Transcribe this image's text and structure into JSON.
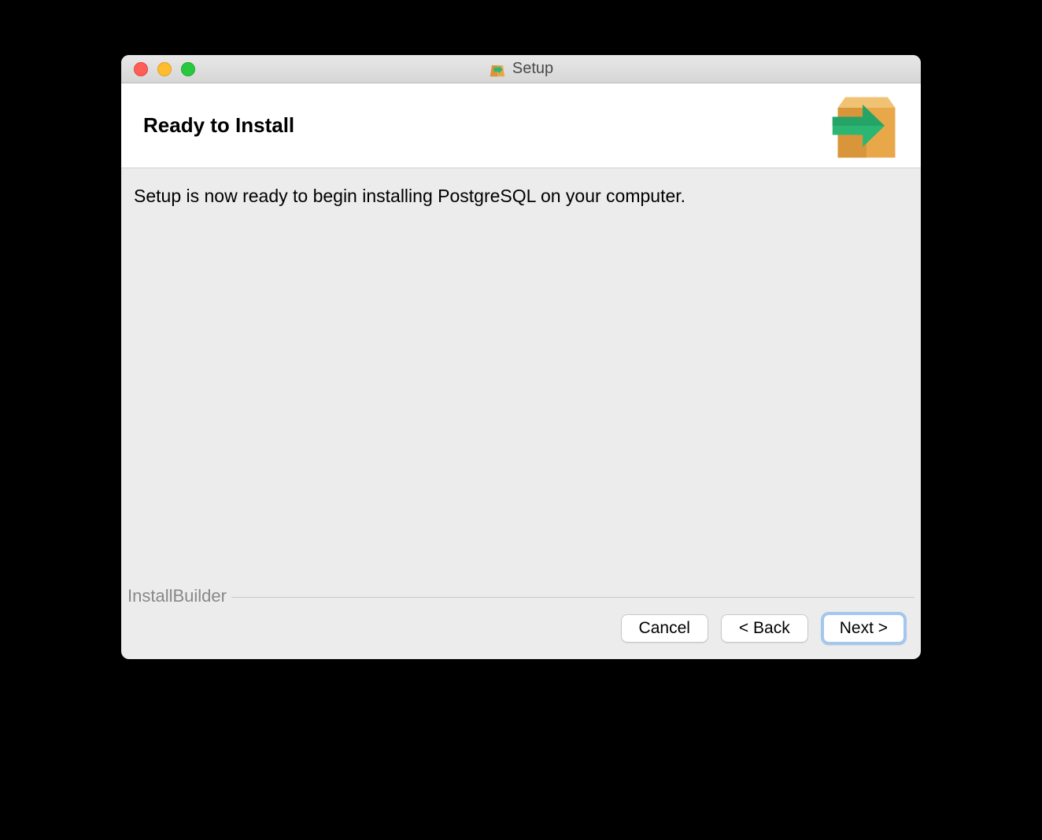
{
  "window": {
    "title": "Setup"
  },
  "header": {
    "title": "Ready to Install"
  },
  "content": {
    "message": "Setup is now ready to begin installing PostgreSQL on your computer."
  },
  "footer": {
    "brand": "InstallBuilder",
    "cancel_label": "Cancel",
    "back_label": "< Back",
    "next_label": "Next >"
  }
}
